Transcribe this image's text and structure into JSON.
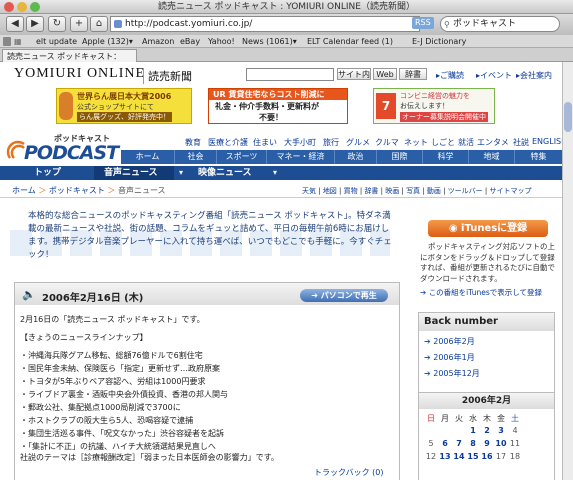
{
  "window": {
    "title": "読売ニュース ポッドキャスト : YOMIURI ONLINE（読売新聞）"
  },
  "toolbar": {
    "back": "◀",
    "forward": "▶",
    "reload": "↻",
    "add": "+",
    "home": "⌂",
    "url": "http://podcast.yomiuri.co.jp/",
    "rss": "RSS",
    "search_value": "ポッドキャスト"
  },
  "bookmarks": [
    "elt update",
    "Apple (132)▾",
    "Amazon",
    "eBay",
    "Yahoo!",
    "News (1061)▾",
    "ELT Calendar feed (1)",
    "E-J Dictionary"
  ],
  "tab": {
    "label": "読売ニュース ポッドキャスト："
  },
  "header": {
    "logo": "YOMIURI ONLINE",
    "logo_sub": "読売新聞",
    "search_btn": "サイト内",
    "web_btn": "Web",
    "dict_btn": "辞書",
    "links": [
      "ご購読",
      "イベント",
      "会社案内"
    ]
  },
  "ads": {
    "ad1_line1": "世界らん展日本大賞2006",
    "ad1_line2": "公式ショップサイトにて",
    "ad1_line3": "らん展グッズ、好評発売中！",
    "ad2_line1": "UR 賃貸住宅ならコスト削減に",
    "ad2_line2": "礼金・仲介手数料・更新料が",
    "ad2_line3": "不要！",
    "ad3_line1": "コンビニ経営の魅力を",
    "ad3_line2": "お伝えします！",
    "ad3_line3": "オーナー募集説明会開催中"
  },
  "podcast_logo": {
    "kana": "ポッドキャスト",
    "title": "PODCAST"
  },
  "nav_top": [
    "教育",
    "医療と介護",
    "住まい",
    "大手小町",
    "旅行",
    "グルメ",
    "クルマ",
    "ネット",
    "しごと",
    "就活",
    "エンタメ",
    "社説",
    "ENGLISH"
  ],
  "nav_main": [
    "ホーム",
    "社会",
    "スポーツ",
    "マネー・経済",
    "政治",
    "国際",
    "科学",
    "地域",
    "特集"
  ],
  "nav_sub": [
    "トップ",
    "音声ニュース",
    "映像ニュース"
  ],
  "breadcrumb": {
    "home": "ホーム",
    "sep": "＞",
    "podcast": "ポッドキャスト",
    "current": "音声ニュース"
  },
  "subnav": [
    "天気",
    "地図",
    "買物",
    "辞書",
    "映画",
    "写真",
    "動画",
    "ツールバー",
    "サイトマップ"
  ],
  "intro": "本格的な総合ニュースのポッドキャスティング番組「読売ニュース ポッドキャスト」。特ダネ満載の最新ニュースや社説、街の話題、コラムをギュッと詰めて、平日の毎朝午前6時にお届けします。携帯デジタル音楽プレーヤーに入れて持ち運べば、いつでもどこでも手軽に。今すぐチェック！",
  "entry": {
    "date": "2006年2月16日 (木)",
    "pc_play": "パソコンで再生",
    "lead": "2月16日の「読売ニュース ポッドキャスト」です。",
    "lineup_title": "【きょうのニュースラインナップ】",
    "items": [
      "・沖縄海兵隊グアム移転、総額76億ドルで6割住宅",
      "・国民年金未納、保険医ら「指定」更新せず…政府原案",
      "・トヨタが5年ぶりベア容認へ、労組は1000円要求",
      "・ライブドア裏金・酒販中央会外債投資、香港の邦人関与",
      "・郵政公社、集配拠点1000局削減で3700に",
      "・ホストクラブの阪大生ら5人、恐喝容疑で逮捕",
      "・集団生活巡る事件、「呪文なかった」渋谷容疑者を起訴",
      "・「集計に不正」の抗議、ハイチ大統領選結果見直しへ"
    ],
    "editorial": "社説のテーマは［診療報酬改定］「弱まった日本医師会の影響力」です。",
    "trackback": "トラックバック (0)"
  },
  "sidebar": {
    "itunes_btn": "iTunesに登録",
    "itunes_text": "ポッドキャスティング対応ソフトの上にボタンをドラッグ＆ドロップして登録すれば、番組が更新されるたびに自動でダウンロードされます。",
    "itunes_link": "この番組をiTunesで表示して登録",
    "back_number_title": "Back number",
    "back_numbers": [
      "2006年2月",
      "2006年1月",
      "2005年12月"
    ],
    "cal_title": "2006年2月",
    "cal_days": [
      "日",
      "月",
      "火",
      "水",
      "木",
      "金",
      "土"
    ],
    "cal_rows": [
      [
        "",
        "",
        "",
        "1",
        "2",
        "3",
        "4"
      ],
      [
        "5",
        "6",
        "7",
        "8",
        "9",
        "10",
        "11"
      ],
      [
        "12",
        "13",
        "14",
        "15",
        "16",
        "17",
        "18"
      ]
    ]
  },
  "colors": {
    "accent_blue": "#1d4d93",
    "nav_blue": "#2a5fa8",
    "orange": "#e8731c"
  }
}
